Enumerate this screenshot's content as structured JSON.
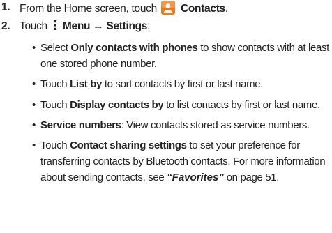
{
  "steps": [
    {
      "number": "1.",
      "before": "From the Home screen, touch",
      "icon": "contacts-app-icon",
      "app_name": "Contacts",
      "after": "."
    },
    {
      "number": "2.",
      "before": "Touch",
      "icon": "menu-dots-icon",
      "menu_path": "Menu → Settings",
      "after": ":"
    }
  ],
  "bullets": [
    {
      "pre": "Select ",
      "bold": "Only contacts with phones",
      "post": " to show contacts with at least one stored phone number."
    },
    {
      "pre": "Touch ",
      "bold": "List by",
      "post": " to sort contacts by first or last name."
    },
    {
      "pre": "Touch ",
      "bold": "Display contacts by",
      "post": " to list contacts by first or last name."
    },
    {
      "pre": "",
      "bold": "Service numbers",
      "post": ": View contacts stored as service numbers."
    },
    {
      "pre": "Touch ",
      "bold": "Contact sharing settings",
      "post": " to set your preference for transferring contacts by Bluetooth contacts. For more information about sending contacts, see ",
      "link": "“Favorites”",
      "tail": " on page 51."
    }
  ],
  "bullet_glyph": "•",
  "colors": {
    "text": "#222222",
    "icon_orange": "#f07b1e",
    "icon_orange_dark": "#d9600a"
  }
}
